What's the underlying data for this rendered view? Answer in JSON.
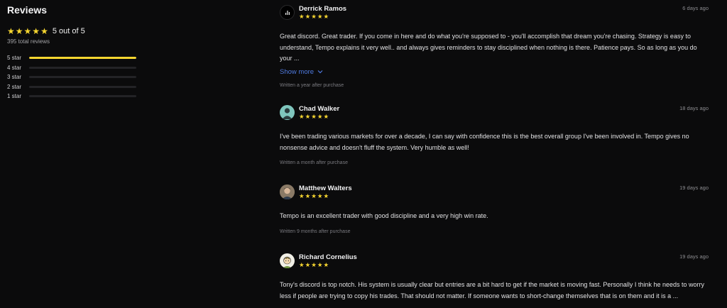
{
  "summary": {
    "title": "Reviews",
    "rating_text": "5 out of 5",
    "total_text": "395 total reviews",
    "rating_value": 5,
    "distribution": [
      {
        "label": "5 star",
        "fraction": 1.0
      },
      {
        "label": "4 star",
        "fraction": 0.0
      },
      {
        "label": "3 star",
        "fraction": 0.0
      },
      {
        "label": "2 star",
        "fraction": 0.0
      },
      {
        "label": "1 star",
        "fraction": 0.0
      }
    ]
  },
  "colors": {
    "star": "#f7d630",
    "link": "#4f7ae0",
    "background": "#0b0b0c"
  },
  "reviews": [
    {
      "name": "Derrick Ramos",
      "time": "6 days ago",
      "stars": 5,
      "avatar_icon": "black-logo-avatar",
      "body": "Great discord. Great trader. If you come in here and do what you're supposed to - you'll accomplish that dream you're chasing. Strategy is easy to understand, Tempo explains it very well.. and always gives reminders to stay disciplined when nothing is there. Patience pays. So as long as you do your ...",
      "show_more": "Show more",
      "meta": "Written a year after purchase"
    },
    {
      "name": "Chad Walker",
      "time": "18 days ago",
      "stars": 5,
      "avatar_icon": "teal-person-avatar",
      "body": "I've been trading various markets for over a decade, I can say with confidence this is the best overall group I've been involved in. Tempo gives no nonsense advice and doesn't fluff the system. Very humble as well!",
      "meta": "Written a month after purchase"
    },
    {
      "name": "Matthew Walters",
      "time": "19 days ago",
      "stars": 5,
      "avatar_icon": "photo-avatar",
      "body": "Tempo is an excellent trader with good discipline and a very high win rate.",
      "meta": "Written 9 months after purchase"
    },
    {
      "name": "Richard Cornelius",
      "time": "19 days ago",
      "stars": 5,
      "avatar_icon": "cartoon-avatar",
      "body": "Tony's discord is top notch. His system is usually clear but entries are a bit hard to get if the market is moving fast. Personally I think he needs to worry less if people are trying to copy his trades. That should not matter. If someone wants to short-change themselves that is on them and it is a ..."
    }
  ]
}
